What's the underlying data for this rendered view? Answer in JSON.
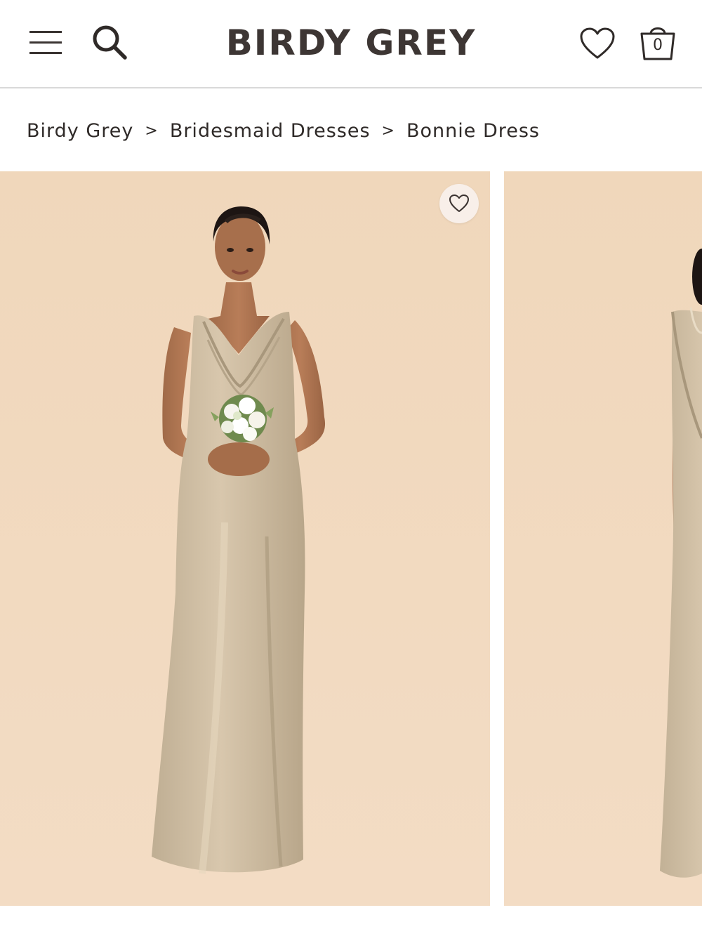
{
  "header": {
    "brand": "BIRDY GREY",
    "icons": {
      "menu": "hamburger-menu-icon",
      "search": "search-icon",
      "wishlist": "heart-icon",
      "bag": "shopping-bag-icon"
    },
    "bag_count": "0"
  },
  "breadcrumb": {
    "items": [
      {
        "label": "Birdy Grey"
      },
      {
        "label": "Bridesmaid Dresses"
      },
      {
        "label": "Bonnie Dress"
      }
    ],
    "separator": ">"
  },
  "gallery": {
    "images": [
      {
        "description": "Model in champagne cowl-neck satin dress holding bouquet, front view"
      },
      {
        "description": "Model in champagne satin dress, back view"
      }
    ],
    "favorite_icon": "heart-icon"
  },
  "colors": {
    "brand_text": "#3d3634",
    "backdrop": "#f0d7bb",
    "dress": "#c9b79d"
  }
}
